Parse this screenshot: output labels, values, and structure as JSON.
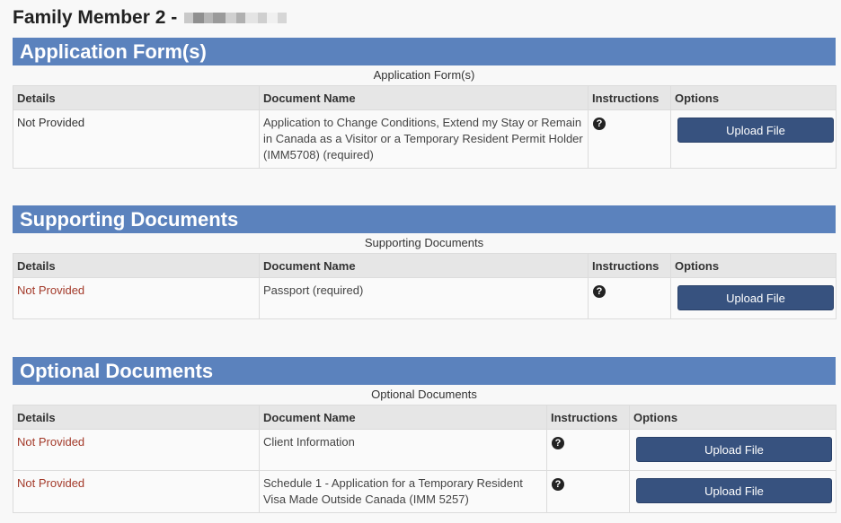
{
  "page": {
    "title": "Family Member 2 -"
  },
  "sections": [
    {
      "header": "Application Form(s)",
      "caption": "Application Form(s)",
      "columns": [
        "Details",
        "Document Name",
        "Instructions",
        "Options"
      ],
      "rows": [
        {
          "details": "Not Provided",
          "document": "Application to Change Conditions, Extend my Stay or Remain in Canada as a Visitor or a Temporary Resident Permit Holder (IMM5708)  (required)",
          "button": "Upload File"
        }
      ]
    },
    {
      "header": "Supporting Documents",
      "caption": "Supporting Documents",
      "columns": [
        "Details",
        "Document Name",
        "Instructions",
        "Options"
      ],
      "rows": [
        {
          "details": "Not Provided",
          "document": "Passport  (required)",
          "button": "Upload File"
        }
      ]
    },
    {
      "header": "Optional Documents",
      "caption": "Optional Documents",
      "columns": [
        "Details",
        "Document Name",
        "Instructions",
        "Options"
      ],
      "rows": [
        {
          "details": "Not Provided",
          "document": "Client Information",
          "button": "Upload File"
        },
        {
          "details": "Not Provided",
          "document": "Schedule 1 - Application for a Temporary Resident Visa Made Outside Canada (IMM 5257)",
          "button": "Upload File"
        }
      ]
    }
  ],
  "icons": {
    "help": "question-circle-icon",
    "help_glyph": "?"
  },
  "colors": {
    "section_header": "#5b82bd",
    "button": "#37527f",
    "not_provided_red": "#a33a2a"
  }
}
